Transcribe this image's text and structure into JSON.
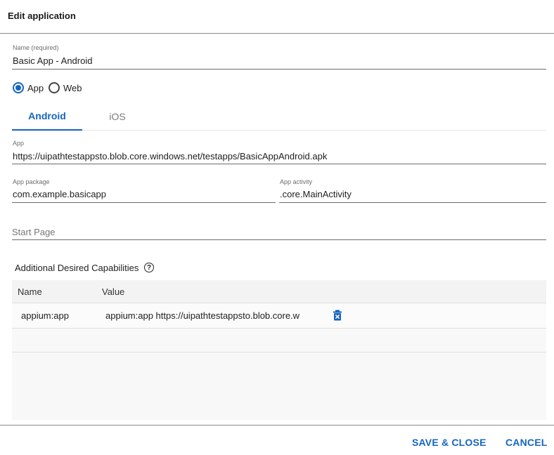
{
  "dialog": {
    "title": "Edit application"
  },
  "name_field": {
    "label": "Name (required)",
    "value": "Basic App - Android"
  },
  "type_radio": {
    "options": [
      {
        "label": "App",
        "checked": true
      },
      {
        "label": "Web",
        "checked": false
      }
    ]
  },
  "platform_tabs": [
    {
      "label": "Android",
      "active": true
    },
    {
      "label": "iOS",
      "active": false
    }
  ],
  "app_field": {
    "label": "App",
    "value": "https://uipathtestappsto.blob.core.windows.net/testapps/BasicAppAndroid.apk"
  },
  "package_field": {
    "label": "App package",
    "value": "com.example.basicapp"
  },
  "activity_field": {
    "label": "App activity",
    "value": ".core.MainActivity"
  },
  "start_page_field": {
    "placeholder": "Start Page",
    "value": ""
  },
  "capabilities": {
    "title": "Additional Desired Capabilities",
    "help_icon": "?",
    "columns": [
      "Name",
      "Value"
    ],
    "rows": [
      {
        "name": "appium:app",
        "value": "appium:app https://uipathtestappsto.blob.core.w"
      }
    ]
  },
  "footer": {
    "save_label": "SAVE & CLOSE",
    "cancel_label": "CANCEL"
  },
  "colors": {
    "accent": "#1565c0",
    "divider": "#8a8a8a",
    "grid_bg": "#f8f8f8"
  },
  "icons": {
    "help": "help-circle-icon",
    "delete": "delete-icon"
  }
}
